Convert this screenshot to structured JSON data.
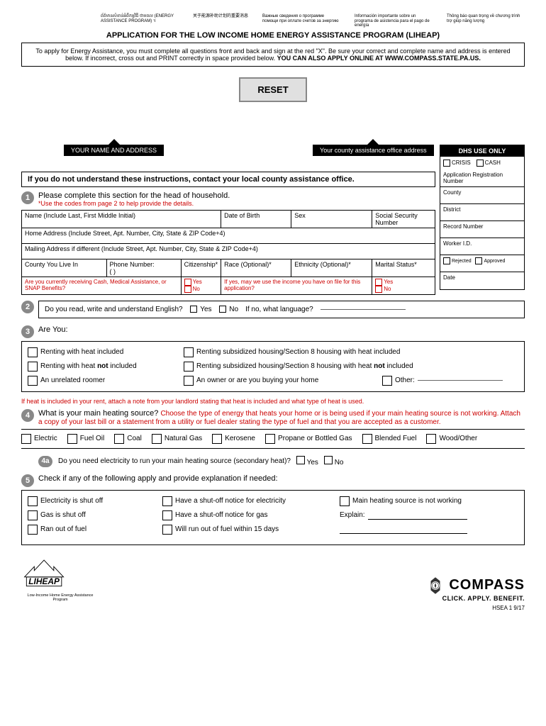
{
  "header": {
    "langs": [
      "ព័ត៌មានសំខាន់អំពីកម្មវិធី ថាមពល\n(ENERGY ASSISTANCE PROGRAM) ។",
      "关于能源补助计划的重要消息",
      "Важные сведения о программе помощи при оплате счетов за энергию",
      "Información importante sobre un programa de asistencia para el pago de energía",
      "Thông báo quan trọng về chương trình trợ giúp năng lượng"
    ],
    "title": "APPLICATION FOR THE LOW INCOME HOME ENERGY ASSISTANCE PROGRAM (LIHEAP)",
    "instructions": "To apply for Energy Assistance, you must complete all questions front and back and sign at the red \"X\". Be sure your correct and complete name and address is entered below. If incorrect, cross out and PRINT correctly in space provided below.",
    "instructions_bold": "YOU CAN ALSO APPLY ONLINE AT WWW.COMPASS.STATE.PA.US."
  },
  "reset_label": "RESET",
  "pointers": {
    "name": "YOUR NAME AND ADDRESS",
    "county": "Your county assistance office address"
  },
  "dhs": {
    "title": "DHS USE ONLY",
    "crisis": "CRISIS",
    "cash": "CASH",
    "fields": [
      "Application Registration Number",
      "County",
      "District",
      "Record Number",
      "Worker I.D."
    ],
    "rejected": "Rejected",
    "approved": "Approved",
    "date": "Date"
  },
  "understand_bar": "If you do not understand these instructions, contact your local county assistance office.",
  "s1": {
    "num": "1",
    "head": "Please complete this section for the head of household.",
    "sub": "*Use the codes from page 2 to help provide the details.",
    "cells": {
      "name": "Name (Include Last, First Middle Initial)",
      "dob": "Date of Birth",
      "sex": "Sex",
      "ssn": "Social Security Number",
      "home": "Home Address (Include Street, Apt. Number, City, State & ZIP Code+4)",
      "mail": "Mailing Address if different (Include Street, Apt. Number, City, State & ZIP Code+4)",
      "county": "County You Live In",
      "phone": "Phone Number:",
      "phone_paren": "(          )",
      "citizenship": "Citizenship*",
      "race": "Race (Optional)*",
      "ethnicity": "Ethnicity (Optional)*",
      "marital": "Marital Status*",
      "snap_q": "Are you currently receiving Cash, Medical Assistance, or SNAP Benefits?",
      "income_q": "If yes, may we use the income you have on file for this application?",
      "yes": "Yes",
      "no": "No"
    }
  },
  "s2": {
    "num": "2",
    "q": "Do you read, write and understand English?",
    "yes": "Yes",
    "no": "No",
    "lang": "If no, what language?"
  },
  "s3": {
    "num": "3",
    "head": "Are You:",
    "opts_col1": [
      "Renting with heat included",
      "Renting with heat not included",
      "An unrelated roomer"
    ],
    "opts_col2": [
      "Renting subsidized housing/Section 8 housing with heat included",
      "Renting subsidized housing/Section 8 housing with heat not included",
      "An owner or are you buying your home"
    ],
    "other": "Other:",
    "note": "If heat is included in your rent, attach a note from your landlord stating that heat is included and what type of heat is used."
  },
  "s4": {
    "num": "4",
    "head": "What is your main heating source?",
    "sub": "Choose the type of energy that heats your home or is being used if your main heating source is not working. Attach a copy of your last bill or a statement from a utility or fuel dealer stating the type of fuel and that you are accepted as a customer.",
    "fuels": [
      "Electric",
      "Fuel Oil",
      "Coal",
      "Natural Gas",
      "Kerosene",
      "Propane or Bottled Gas",
      "Blended Fuel",
      "Wood/Other"
    ]
  },
  "s4a": {
    "num": "4a",
    "q": "Do you need electricity to run your main heating source (secondary heat)?",
    "yes": "Yes",
    "no": "No"
  },
  "s5": {
    "num": "5",
    "head": "Check if any of the following apply and provide explanation if needed:",
    "col1": [
      "Electricity is shut off",
      "Gas is shut off",
      "Ran out of fuel"
    ],
    "col2": [
      "Have a shut-off notice for electricity",
      "Have a shut-off notice for gas",
      "Will run out of fuel within 15 days"
    ],
    "col3": [
      "Main heating source is not working",
      "Explain:"
    ]
  },
  "footer": {
    "liheap_sub": "Low-Income Home Energy Assistance Program",
    "compass": "COMPASS",
    "compass_sub": "CLICK. APPLY. BENEFIT.",
    "form_id": "HSEA 1   9/17"
  }
}
